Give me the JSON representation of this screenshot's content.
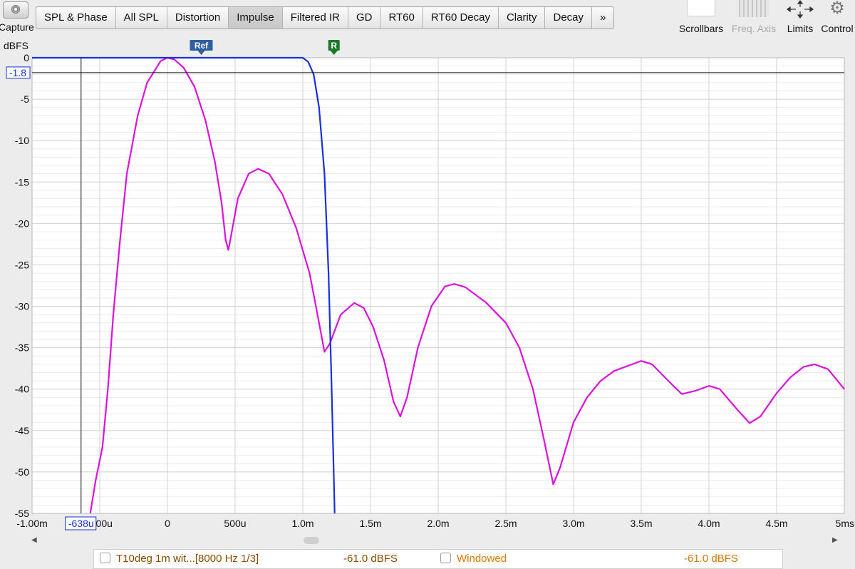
{
  "toolbar": {
    "capture_label": "Capture",
    "tabs": [
      {
        "label": "SPL & Phase",
        "name": "tab-spl-phase"
      },
      {
        "label": "All SPL",
        "name": "tab-all-spl"
      },
      {
        "label": "Distortion",
        "name": "tab-distortion"
      },
      {
        "label": "Impulse",
        "name": "tab-impulse",
        "active": true
      },
      {
        "label": "Filtered IR",
        "name": "tab-filtered-ir"
      },
      {
        "label": "GD",
        "name": "tab-gd"
      },
      {
        "label": "RT60",
        "name": "tab-rt60"
      },
      {
        "label": "RT60 Decay",
        "name": "tab-rt60-decay"
      },
      {
        "label": "Clarity",
        "name": "tab-clarity"
      },
      {
        "label": "Decay",
        "name": "tab-decay"
      },
      {
        "label": "»",
        "name": "tab-more"
      }
    ],
    "scrollbars_label": "Scrollbars",
    "freq_axis_label": "Freq. Axis",
    "limits_label": "Limits",
    "controls_label": "Control"
  },
  "chart_data": {
    "type": "line",
    "ylabel": "dBFS",
    "ylim": [
      -55,
      0
    ],
    "xlim": [
      -1.0,
      5.0
    ],
    "x_unit": "ms",
    "y_ticks": [
      "0",
      "-5",
      "-10",
      "-15",
      "-20",
      "-25",
      "-30",
      "-35",
      "-40",
      "-45",
      "-50",
      "-55"
    ],
    "x_ticks": [
      {
        "v": -1.0,
        "label": "-1.00m"
      },
      {
        "v": -0.5,
        "label": "-500u"
      },
      {
        "v": 0,
        "label": "0"
      },
      {
        "v": 0.5,
        "label": "500u"
      },
      {
        "v": 1.0,
        "label": "1.0m"
      },
      {
        "v": 1.5,
        "label": "1.5m"
      },
      {
        "v": 2.0,
        "label": "2.0m"
      },
      {
        "v": 2.5,
        "label": "2.5m"
      },
      {
        "v": 3.0,
        "label": "3.0m"
      },
      {
        "v": 3.5,
        "label": "3.5m"
      },
      {
        "v": 4.0,
        "label": "4.0m"
      },
      {
        "v": 4.5,
        "label": "4.5m"
      },
      {
        "v": 5.0,
        "label": "5ms"
      }
    ],
    "cursor": {
      "x": -0.638,
      "y": -1.8,
      "x_label": "-638u",
      "y_label": "-1.8"
    },
    "markers": [
      {
        "label": "Ref",
        "x": 0.25,
        "color": "#2f5f9e"
      },
      {
        "label": "R",
        "x": 1.23,
        "color": "#1a7a2a"
      }
    ],
    "series": [
      {
        "color": "#dd11dd",
        "points": [
          [
            -0.57,
            -55
          ],
          [
            -0.53,
            -51
          ],
          [
            -0.48,
            -47
          ],
          [
            -0.44,
            -40
          ],
          [
            -0.4,
            -31
          ],
          [
            -0.35,
            -22
          ],
          [
            -0.3,
            -14
          ],
          [
            -0.22,
            -7
          ],
          [
            -0.15,
            -3
          ],
          [
            -0.05,
            -0.4
          ],
          [
            0,
            0
          ],
          [
            0.05,
            -0.2
          ],
          [
            0.12,
            -1.2
          ],
          [
            0.2,
            -3.5
          ],
          [
            0.28,
            -7.5
          ],
          [
            0.35,
            -12.5
          ],
          [
            0.4,
            -17.5
          ],
          [
            0.43,
            -22
          ],
          [
            0.45,
            -23.2
          ],
          [
            0.47,
            -21.5
          ],
          [
            0.52,
            -17
          ],
          [
            0.6,
            -14
          ],
          [
            0.67,
            -13.4
          ],
          [
            0.75,
            -14
          ],
          [
            0.85,
            -16.5
          ],
          [
            0.95,
            -20.5
          ],
          [
            1.05,
            -26
          ],
          [
            1.12,
            -32
          ],
          [
            1.16,
            -35.5
          ],
          [
            1.2,
            -34.5
          ],
          [
            1.28,
            -31
          ],
          [
            1.38,
            -29.6
          ],
          [
            1.45,
            -30.2
          ],
          [
            1.52,
            -32.5
          ],
          [
            1.6,
            -36.5
          ],
          [
            1.67,
            -41.5
          ],
          [
            1.72,
            -43.3
          ],
          [
            1.77,
            -41
          ],
          [
            1.85,
            -35
          ],
          [
            1.95,
            -30
          ],
          [
            2.05,
            -27.6
          ],
          [
            2.12,
            -27.3
          ],
          [
            2.2,
            -27.7
          ],
          [
            2.35,
            -29.5
          ],
          [
            2.5,
            -32
          ],
          [
            2.6,
            -35
          ],
          [
            2.7,
            -40
          ],
          [
            2.78,
            -46
          ],
          [
            2.85,
            -51.5
          ],
          [
            2.9,
            -49.5
          ],
          [
            3.0,
            -44
          ],
          [
            3.1,
            -41
          ],
          [
            3.2,
            -39
          ],
          [
            3.3,
            -37.8
          ],
          [
            3.4,
            -37.2
          ],
          [
            3.5,
            -36.6
          ],
          [
            3.58,
            -37
          ],
          [
            3.7,
            -39
          ],
          [
            3.8,
            -40.6
          ],
          [
            3.9,
            -40.2
          ],
          [
            4.0,
            -39.6
          ],
          [
            4.08,
            -40
          ],
          [
            4.2,
            -42.3
          ],
          [
            4.3,
            -44.1
          ],
          [
            4.38,
            -43.3
          ],
          [
            4.5,
            -40.5
          ],
          [
            4.6,
            -38.6
          ],
          [
            4.7,
            -37.3
          ],
          [
            4.78,
            -37
          ],
          [
            4.88,
            -37.6
          ],
          [
            5.0,
            -40
          ]
        ]
      },
      {
        "color": "#1530e0",
        "points": [
          [
            -1.0,
            0
          ],
          [
            1.0,
            0
          ],
          [
            1.04,
            -0.5
          ],
          [
            1.08,
            -2
          ],
          [
            1.12,
            -6
          ],
          [
            1.16,
            -14
          ],
          [
            1.19,
            -26
          ],
          [
            1.21,
            -38
          ],
          [
            1.225,
            -48
          ],
          [
            1.235,
            -55
          ]
        ]
      }
    ]
  },
  "legend": {
    "items": [
      {
        "label": "T10deg 1m wit...[8000 Hz 1/3]",
        "value": "-61.0 dBFS",
        "color": "#8a4a00"
      },
      {
        "label": "Windowed",
        "value": "-61.0 dBFS",
        "color": "#d47a00"
      }
    ]
  }
}
